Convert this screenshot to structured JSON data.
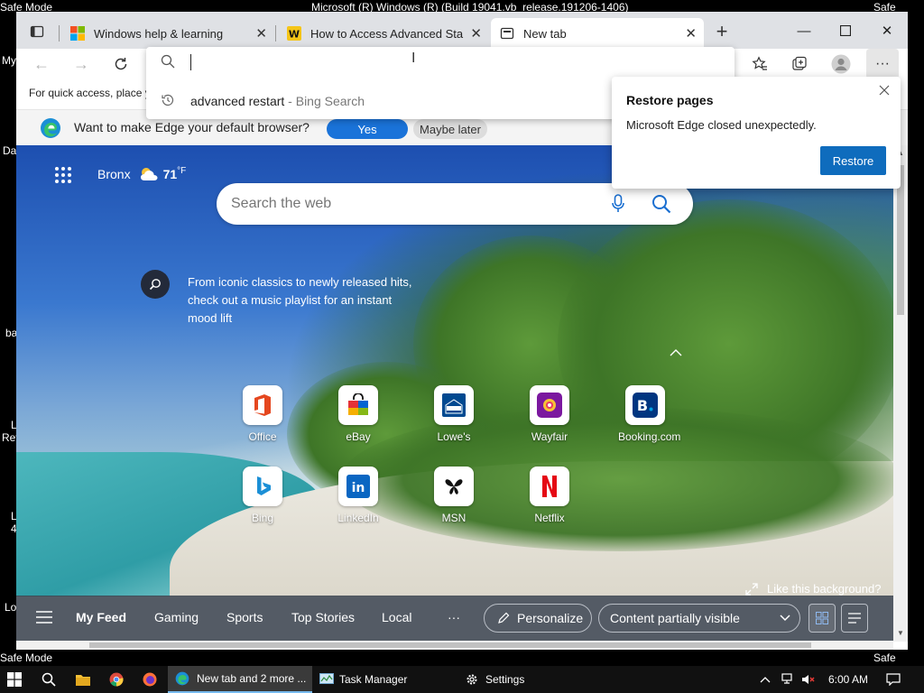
{
  "system": {
    "title": "Microsoft (R) Windows (R) (Build 19041.vb_release.191206-1406)",
    "safe_mode": "Safe Mode"
  },
  "desktop_fragments": [
    "My",
    "Da",
    "ba",
    "L",
    "Rev",
    "L",
    "4",
    "Lo"
  ],
  "tabs": [
    {
      "title": "Windows help & learning"
    },
    {
      "title": "How to Access Advanced Startup"
    },
    {
      "title": "New tab"
    }
  ],
  "toolbar": {
    "address_value": ""
  },
  "favorites_bar": {
    "text": "For quick access, place y"
  },
  "address_suggestion": {
    "query": "advanced restart",
    "source": " - Bing Search"
  },
  "infobar": {
    "question": "Want to make Edge your default browser?",
    "yes": "Yes",
    "later": "Maybe later"
  },
  "restore_popup": {
    "title": "Restore pages",
    "message": "Microsoft Edge closed unexpectedly.",
    "button": "Restore"
  },
  "weather": {
    "location": "Bronx",
    "temp": "71",
    "unit": "°F"
  },
  "ntp_search": {
    "placeholder": "Search the web"
  },
  "promo": {
    "text": "From iconic classics to newly released hits, check out a music playlist for an instant mood lift"
  },
  "quick_links": [
    {
      "label": "Office"
    },
    {
      "label": "eBay"
    },
    {
      "label": "Lowe's"
    },
    {
      "label": "Wayfair"
    },
    {
      "label": "Booking.com"
    },
    {
      "label": "Bing"
    },
    {
      "label": "LinkedIn"
    },
    {
      "label": "MSN"
    },
    {
      "label": "Netflix"
    }
  ],
  "background_link": "Like this background?",
  "feed": {
    "tabs": [
      "My Feed",
      "Gaming",
      "Sports",
      "Top Stories",
      "Local"
    ],
    "more": "···",
    "personalize": "Personalize",
    "content_visibility": "Content partially visible"
  },
  "taskbar": {
    "edge_label": "New tab and 2 more ...",
    "task_manager": "Task Manager",
    "settings": "Settings",
    "time": "6:00 AM"
  }
}
